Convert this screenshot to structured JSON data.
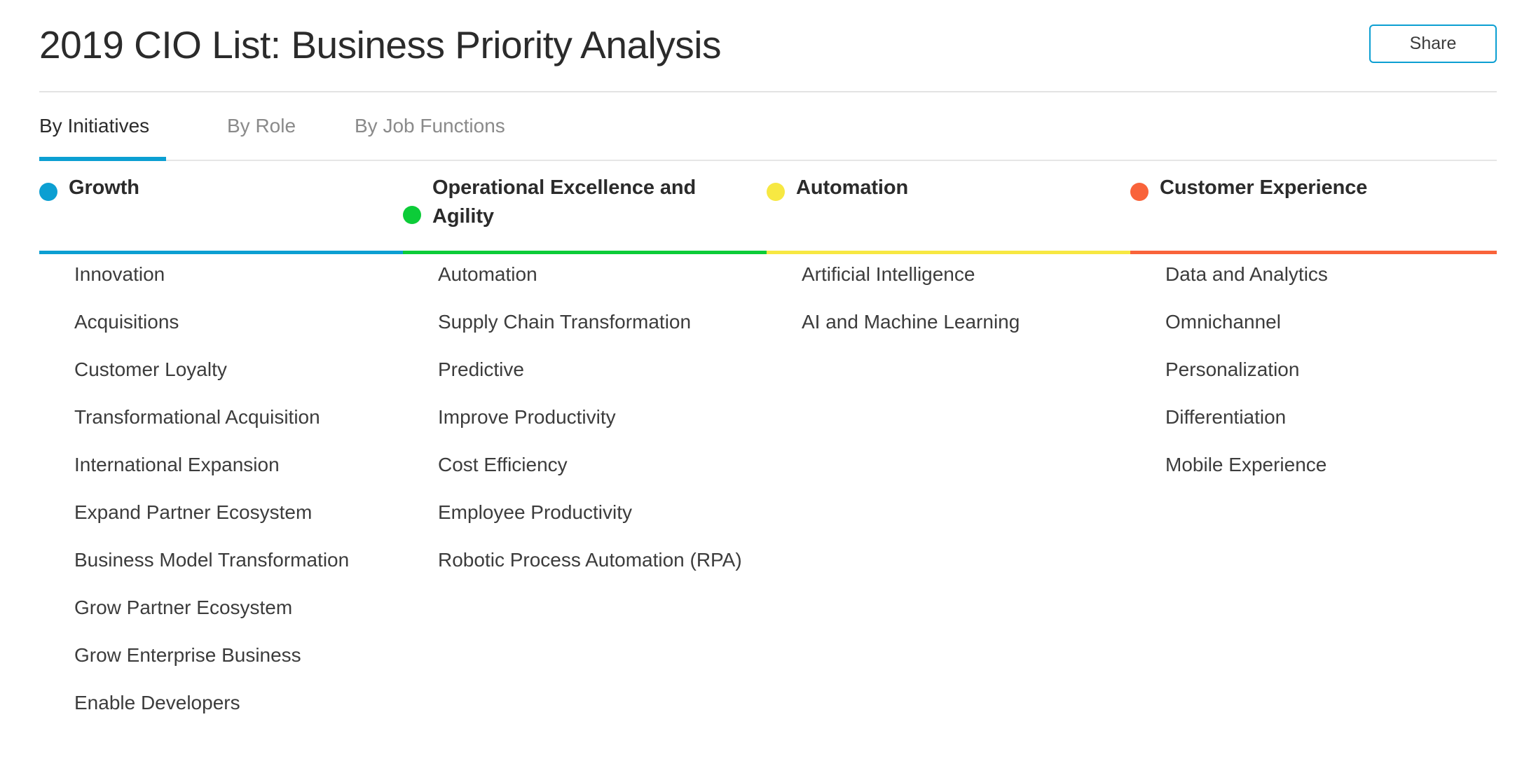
{
  "header": {
    "title": "2019 CIO List: Business Priority Analysis",
    "share_label": "Share"
  },
  "tabs": {
    "active_index": 0,
    "items": [
      {
        "label": "By Initiatives"
      },
      {
        "label": "By Role"
      },
      {
        "label": "By Job Functions"
      }
    ]
  },
  "colors": {
    "accent": "#0c9fd2",
    "growth": "#0c9fd2",
    "operational_excellence": "#0ccc38",
    "automation": "#f7e842",
    "customer_experience": "#f9633a",
    "divider": "#e3e3e3",
    "text": "#3c3c3c",
    "tab_inactive": "#8a8a8a"
  },
  "columns": [
    {
      "title": "Growth",
      "dot_color": "#0c9fd2",
      "bar_color": "#0c9fd2",
      "items": [
        "Innovation",
        "Acquisitions",
        "Customer Loyalty",
        "Transformational Acquisition",
        "International Expansion",
        "Expand Partner Ecosystem",
        "Business Model Transformation",
        "Grow Partner Ecosystem",
        "Grow Enterprise Business",
        "Enable Developers"
      ]
    },
    {
      "title": "Operational Excellence and Agility",
      "dot_color": "#0ccc38",
      "bar_color": "#0ccc38",
      "items": [
        "Automation",
        "Supply Chain Transformation",
        "Predictive",
        "Improve Productivity",
        "Cost Efficiency",
        "Employee Productivity",
        "Robotic Process Automation (RPA)"
      ]
    },
    {
      "title": "Automation",
      "dot_color": "#f7e842",
      "bar_color": "#f7e842",
      "items": [
        "Artificial Intelligence",
        "AI and Machine Learning"
      ]
    },
    {
      "title": "Customer Experience",
      "dot_color": "#f9633a",
      "bar_color": "#f9633a",
      "items": [
        "Data and Analytics",
        "Omnichannel",
        "Personalization",
        "Differentiation",
        "Mobile Experience"
      ]
    }
  ]
}
